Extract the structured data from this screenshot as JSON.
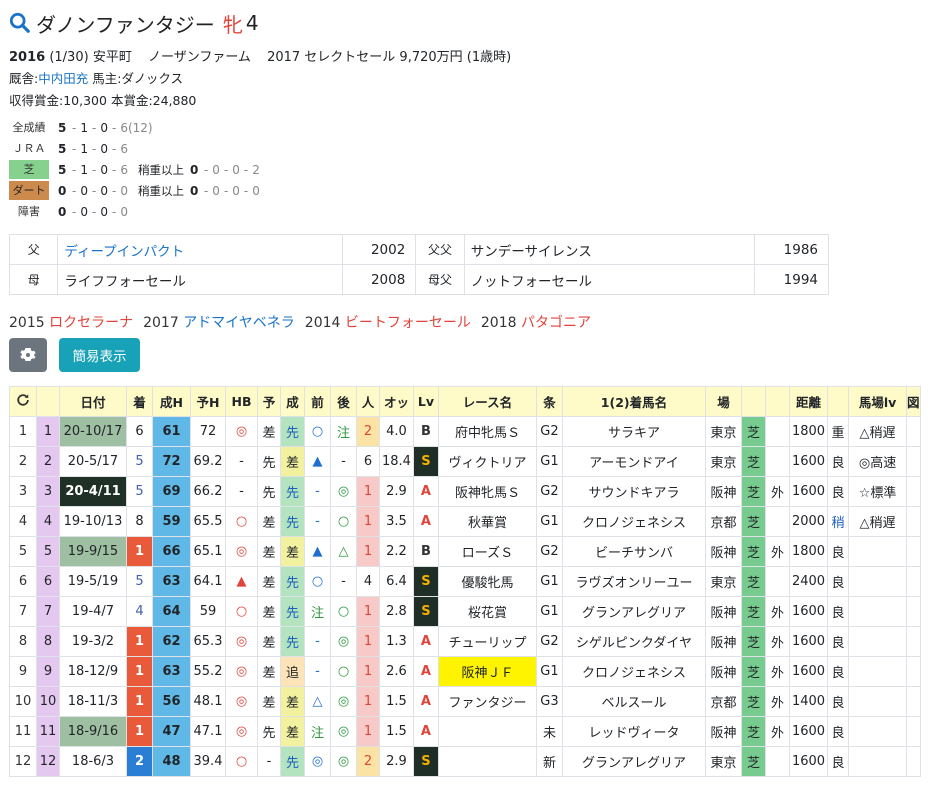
{
  "title": {
    "name": "ダノンファンタジー",
    "sex": "牝",
    "age": "4"
  },
  "info": {
    "birth_year": "2016",
    "birth_date": "(1/30)",
    "area": "安平町",
    "farm": "ノーザンファーム",
    "sale": "2017 セレクトセール 9,720万円 (1歳時)",
    "trainer_label": "厩舎:",
    "trainer": "中内田充",
    "owner_label": "馬主:",
    "owner": "ダノックス",
    "earnings": "収得賞金:10,300",
    "prize": "本賞金:24,880"
  },
  "records": [
    {
      "label": "全成績",
      "style": "plain",
      "w": "5",
      "rest": [
        "1",
        "0"
      ],
      "last": "6",
      "extra": "(12)"
    },
    {
      "label": "ＪＲＡ",
      "style": "plain",
      "w": "5",
      "rest": [
        "1",
        "0"
      ],
      "last": "6",
      "extra": ""
    },
    {
      "label": "芝",
      "style": "turf",
      "w": "5",
      "rest": [
        "1",
        "0"
      ],
      "last": "6",
      "heavy_label": "稍重以上",
      "heavy": [
        "0",
        "0",
        "0",
        "2"
      ]
    },
    {
      "label": "ダート",
      "style": "dirt",
      "w": "0",
      "rest": [
        "0",
        "0"
      ],
      "last": "0",
      "heavy_label": "稍重以上",
      "heavy": [
        "0",
        "0",
        "0",
        "0"
      ]
    },
    {
      "label": "障害",
      "style": "plain",
      "w": "0",
      "rest": [
        "0",
        "0"
      ],
      "last": "0",
      "extra": ""
    }
  ],
  "pedigree": {
    "sire_label": "父",
    "sire": "ディープインパクト",
    "sire_year": "2002",
    "ss_label": "父父",
    "ss": "サンデーサイレンス",
    "ss_year": "1986",
    "dam_label": "母",
    "dam": "ライフフォーセール",
    "dam_year": "2008",
    "ds_label": "母父",
    "ds": "ノットフォーセール",
    "ds_year": "1994"
  },
  "siblings": [
    {
      "year": "2015",
      "name": "ロクセラーナ",
      "color": "red"
    },
    {
      "year": "2017",
      "name": "アドマイヤベネラ",
      "color": "blue"
    },
    {
      "year": "2014",
      "name": "ビートフォーセール",
      "color": "red"
    },
    {
      "year": "2018",
      "name": "パタゴニア",
      "color": "red"
    }
  ],
  "buttons": {
    "simple": "簡易表示"
  },
  "headers": [
    "",
    "",
    "日付",
    "着",
    "成H",
    "予H",
    "HB",
    "予",
    "成",
    "前",
    "後",
    "人",
    "オッ",
    "Lv",
    "レース名",
    "条",
    "1(2)着馬名",
    "場",
    "",
    "",
    "距離",
    "",
    "馬場lv",
    "図"
  ],
  "races": [
    {
      "no": "1",
      "num": "1",
      "date": "20-10/17",
      "date_style": "g",
      "fin": "6",
      "fin_style": "",
      "h": "61",
      "yh": "72",
      "hb": "◎",
      "yo": "差",
      "sei": "先",
      "mae": "○",
      "ato": "注",
      "pop": "2",
      "pop_style": "p2",
      "odds": "4.0",
      "lv": "B",
      "race": "府中牝馬Ｓ",
      "race_hl": false,
      "cls": "G2",
      "winner": "サラキア",
      "venue": "東京",
      "surf": "芝",
      "turn": "",
      "dist": "1800",
      "cond": "重",
      "baba": "△稍遅"
    },
    {
      "no": "2",
      "num": "2",
      "date": "20-5/17",
      "date_style": "",
      "fin": "5",
      "fin_style": "p4",
      "h": "72",
      "yh": "69.2",
      "hb": "-",
      "yo": "先",
      "sei": "差",
      "mae": "▲",
      "ato": "-",
      "pop": "6",
      "pop_style": "",
      "odds": "18.4",
      "lv": "S",
      "race": "ヴィクトリア",
      "race_hl": false,
      "cls": "G1",
      "winner": "アーモンドアイ",
      "venue": "東京",
      "surf": "芝",
      "turn": "",
      "dist": "1600",
      "cond": "良",
      "baba": "◎高速"
    },
    {
      "no": "3",
      "num": "3",
      "date": "20-4/11",
      "date_style": "dk",
      "fin": "5",
      "fin_style": "p4",
      "h": "69",
      "yh": "66.2",
      "hb": "-",
      "yo": "先",
      "sei": "先",
      "mae": "-",
      "ato": "◎",
      "pop": "1",
      "pop_style": "p1",
      "odds": "2.9",
      "lv": "A",
      "race": "阪神牝馬Ｓ",
      "race_hl": false,
      "cls": "G2",
      "winner": "サウンドキアラ",
      "venue": "阪神",
      "surf": "芝",
      "turn": "外",
      "dist": "1600",
      "cond": "良",
      "baba": "☆標準"
    },
    {
      "no": "4",
      "num": "4",
      "date": "19-10/13",
      "date_style": "",
      "fin": "8",
      "fin_style": "",
      "h": "59",
      "yh": "65.5",
      "hb": "○",
      "yo": "差",
      "sei": "先",
      "mae": "-",
      "ato": "○",
      "pop": "1",
      "pop_style": "p1",
      "odds": "3.5",
      "lv": "A",
      "race": "秋華賞",
      "race_hl": false,
      "cls": "G1",
      "winner": "クロノジェネシス",
      "venue": "京都",
      "surf": "芝",
      "turn": "",
      "dist": "2000",
      "cond": "稍",
      "baba": "△稍遅"
    },
    {
      "no": "5",
      "num": "5",
      "date": "19-9/15",
      "date_style": "g",
      "fin": "1",
      "fin_style": "p1",
      "h": "66",
      "yh": "65.1",
      "hb": "◎",
      "yo": "差",
      "sei": "差",
      "mae": "▲",
      "ato": "△",
      "pop": "1",
      "pop_style": "p1",
      "odds": "2.2",
      "lv": "B",
      "race": "ローズＳ",
      "race_hl": false,
      "cls": "G2",
      "winner": "ビーチサンバ",
      "venue": "阪神",
      "surf": "芝",
      "turn": "外",
      "dist": "1800",
      "cond": "良",
      "baba": ""
    },
    {
      "no": "6",
      "num": "6",
      "date": "19-5/19",
      "date_style": "",
      "fin": "5",
      "fin_style": "p4",
      "h": "63",
      "yh": "64.1",
      "hb": "▲",
      "yo": "差",
      "sei": "先",
      "mae": "○",
      "ato": "-",
      "pop": "4",
      "pop_style": "",
      "odds": "6.4",
      "lv": "S",
      "race": "優駿牝馬",
      "race_hl": false,
      "cls": "G1",
      "winner": "ラヴズオンリーユー",
      "venue": "東京",
      "surf": "芝",
      "turn": "",
      "dist": "2400",
      "cond": "良",
      "baba": ""
    },
    {
      "no": "7",
      "num": "7",
      "date": "19-4/7",
      "date_style": "",
      "fin": "4",
      "fin_style": "p4",
      "h": "64",
      "yh": "59",
      "hb": "○",
      "yo": "差",
      "sei": "先",
      "mae": "注",
      "ato": "○",
      "pop": "1",
      "pop_style": "p1",
      "odds": "2.8",
      "lv": "S",
      "race": "桜花賞",
      "race_hl": false,
      "cls": "G1",
      "winner": "グランアレグリア",
      "venue": "阪神",
      "surf": "芝",
      "turn": "外",
      "dist": "1600",
      "cond": "良",
      "baba": ""
    },
    {
      "no": "8",
      "num": "8",
      "date": "19-3/2",
      "date_style": "",
      "fin": "1",
      "fin_style": "p1",
      "h": "62",
      "yh": "65.3",
      "hb": "◎",
      "yo": "差",
      "sei": "先",
      "mae": "-",
      "ato": "◎",
      "pop": "1",
      "pop_style": "p1",
      "odds": "1.3",
      "lv": "A",
      "race": "チューリップ",
      "race_hl": false,
      "cls": "G2",
      "winner": "シゲルピンクダイヤ",
      "venue": "阪神",
      "surf": "芝",
      "turn": "外",
      "dist": "1600",
      "cond": "良",
      "baba": ""
    },
    {
      "no": "9",
      "num": "9",
      "date": "18-12/9",
      "date_style": "",
      "fin": "1",
      "fin_style": "p1",
      "h": "63",
      "yh": "55.2",
      "hb": "◎",
      "yo": "差",
      "sei": "追",
      "mae": "-",
      "ato": "○",
      "pop": "1",
      "pop_style": "p1",
      "odds": "2.6",
      "lv": "A",
      "race": "阪神ＪＦ",
      "race_hl": true,
      "cls": "G1",
      "winner": "クロノジェネシス",
      "venue": "阪神",
      "surf": "芝",
      "turn": "外",
      "dist": "1600",
      "cond": "良",
      "baba": ""
    },
    {
      "no": "10",
      "num": "10",
      "date": "18-11/3",
      "date_style": "",
      "fin": "1",
      "fin_style": "p1",
      "h": "56",
      "yh": "48.1",
      "hb": "◎",
      "yo": "差",
      "sei": "差",
      "mae": "△",
      "ato": "◎",
      "pop": "1",
      "pop_style": "p1",
      "odds": "1.5",
      "lv": "A",
      "race": "ファンタジー",
      "race_hl": false,
      "cls": "G3",
      "winner": "ベルスール",
      "venue": "京都",
      "surf": "芝",
      "turn": "外",
      "dist": "1400",
      "cond": "良",
      "baba": ""
    },
    {
      "no": "11",
      "num": "11",
      "date": "18-9/16",
      "date_style": "g",
      "fin": "1",
      "fin_style": "p1",
      "h": "47",
      "yh": "47.1",
      "hb": "◎",
      "yo": "先",
      "sei": "差",
      "mae": "注",
      "ato": "◎",
      "pop": "1",
      "pop_style": "p1",
      "odds": "1.5",
      "lv": "A",
      "race": "",
      "race_hl": false,
      "cls": "未",
      "winner": "レッドヴィータ",
      "venue": "阪神",
      "surf": "芝",
      "turn": "外",
      "dist": "1600",
      "cond": "良",
      "baba": ""
    },
    {
      "no": "12",
      "num": "12",
      "date": "18-6/3",
      "date_style": "",
      "fin": "2",
      "fin_style": "p2",
      "h": "48",
      "yh": "39.4",
      "hb": "○",
      "yo": "-",
      "sei": "先",
      "mae": "◎",
      "ato": "◎",
      "pop": "2",
      "pop_style": "p2",
      "odds": "2.9",
      "lv": "S",
      "race": "",
      "race_hl": false,
      "cls": "新",
      "winner": "グランアレグリア",
      "venue": "東京",
      "surf": "芝",
      "turn": "",
      "dist": "1600",
      "cond": "良",
      "baba": ""
    }
  ]
}
